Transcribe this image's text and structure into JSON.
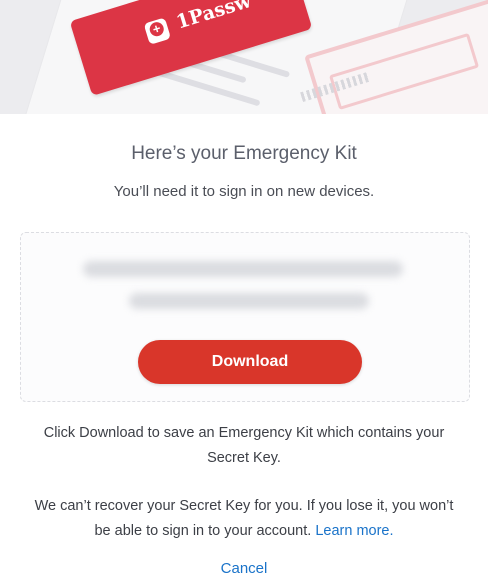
{
  "hero": {
    "brand": "1Passw",
    "icon": "onepassword-logo-icon"
  },
  "dialog": {
    "title": "Here’s your Emergency Kit",
    "subtitle": "You’ll need it to sign in on new devices.",
    "download_label": "Download",
    "info_text": "Click Download to save an Emergency Kit which contains your Secret Key.",
    "warning_text": "We can’t recover your Secret Key for you. If you lose it, you won’t be able to sign in to your account.",
    "learn_more_label": "Learn more.",
    "cancel_label": "Cancel"
  },
  "colors": {
    "accent": "#d9362a",
    "link": "#1a73c9",
    "brand_red": "#dc3545"
  }
}
